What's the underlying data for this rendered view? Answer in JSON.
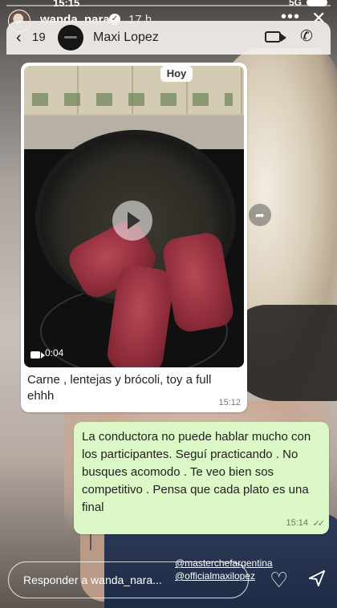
{
  "statusbar": {
    "time": "15:15",
    "network": "5G"
  },
  "story": {
    "username": "wanda_nara",
    "age": "17 h"
  },
  "whatsapp": {
    "unread_count": "19",
    "contact_name": "Maxi Lopez",
    "media_badge": "Hoy",
    "video_duration": "0:04",
    "caption": "Carne , lentejas y brócoli, toy a full ehhh",
    "caption_time": "15:12",
    "reply_text": "La conductora no puede hablar mucho con los participantes. Seguí practicando . No busques acomodo . Te veo bien sos competitivo . Pensa que cada plato es una final",
    "reply_time": "15:14"
  },
  "footer": {
    "reply_placeholder": "Responder a wanda_nara...",
    "mention_1": "@masterchefargentina",
    "mention_2": "@officialmaxilopez"
  },
  "icons": [
    "verified-icon",
    "more-icon",
    "close-icon",
    "back-icon",
    "video-call-icon",
    "phone-icon",
    "play-icon",
    "forward-icon",
    "heart-icon",
    "send-icon"
  ]
}
